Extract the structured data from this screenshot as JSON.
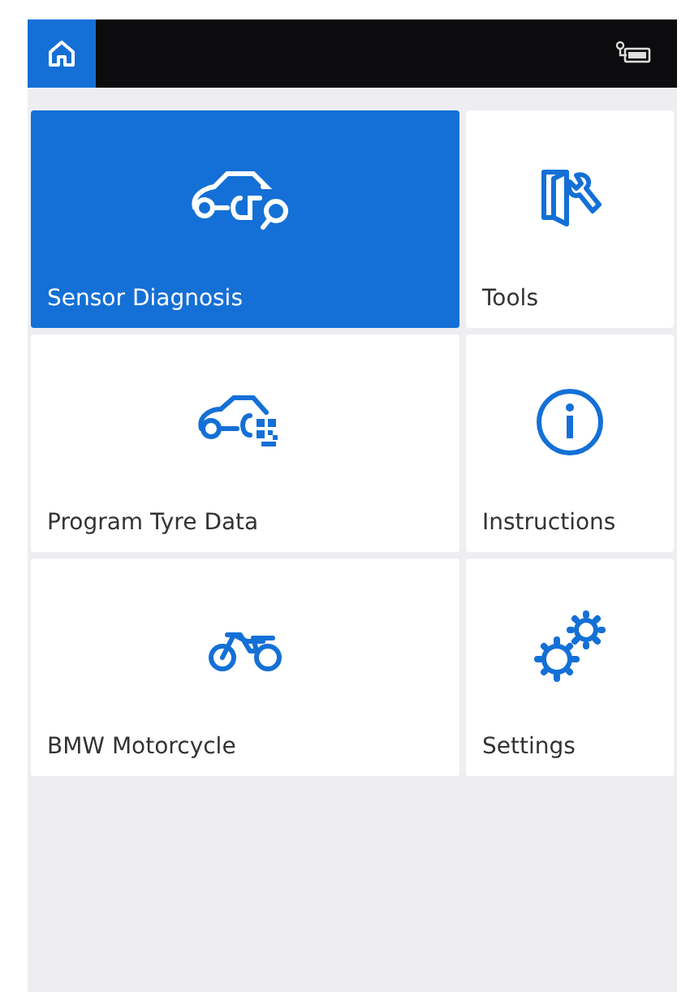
{
  "tiles": [
    {
      "label": "Sensor Diagnosis",
      "selected": true
    },
    {
      "label": "Tools",
      "selected": false
    },
    {
      "label": "Program Tyre Data",
      "selected": false
    },
    {
      "label": "Instructions",
      "selected": false
    },
    {
      "label": "BMW Motorcycle",
      "selected": false
    },
    {
      "label": "Settings",
      "selected": false
    }
  ]
}
